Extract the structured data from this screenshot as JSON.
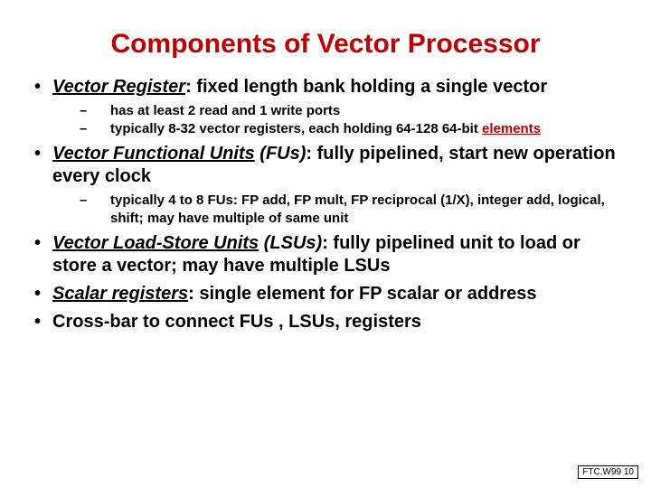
{
  "title": "Components of Vector Processor",
  "b1": {
    "term": "Vector Register",
    "rest": ": fixed length bank holding a single vector",
    "s1": "has at least 2 read and 1 write ports",
    "s2a": "typically 8-32 vector registers, each holding 64-128 64-bit ",
    "s2b": "elements"
  },
  "b2": {
    "term": "Vector Functional Units",
    "abbr": " (FUs)",
    "rest": ": fully pipelined, start new operation every clock",
    "s1": "typically 4 to 8 FUs: FP add, FP mult, FP reciprocal (1/X),    integer add, logical,  shift; may have multiple of same unit"
  },
  "b3": {
    "term": "Vector Load-Store Units",
    "abbr": " (LSUs)",
    "rest": ": fully pipelined unit to load or store a vector; may have multiple LSUs"
  },
  "b4": {
    "term": "Scalar registers",
    "rest": ": single element for FP scalar or address"
  },
  "b5": {
    "text": "Cross-bar to connect FUs , LSUs, registers"
  },
  "footer": "FTC.W99 10"
}
